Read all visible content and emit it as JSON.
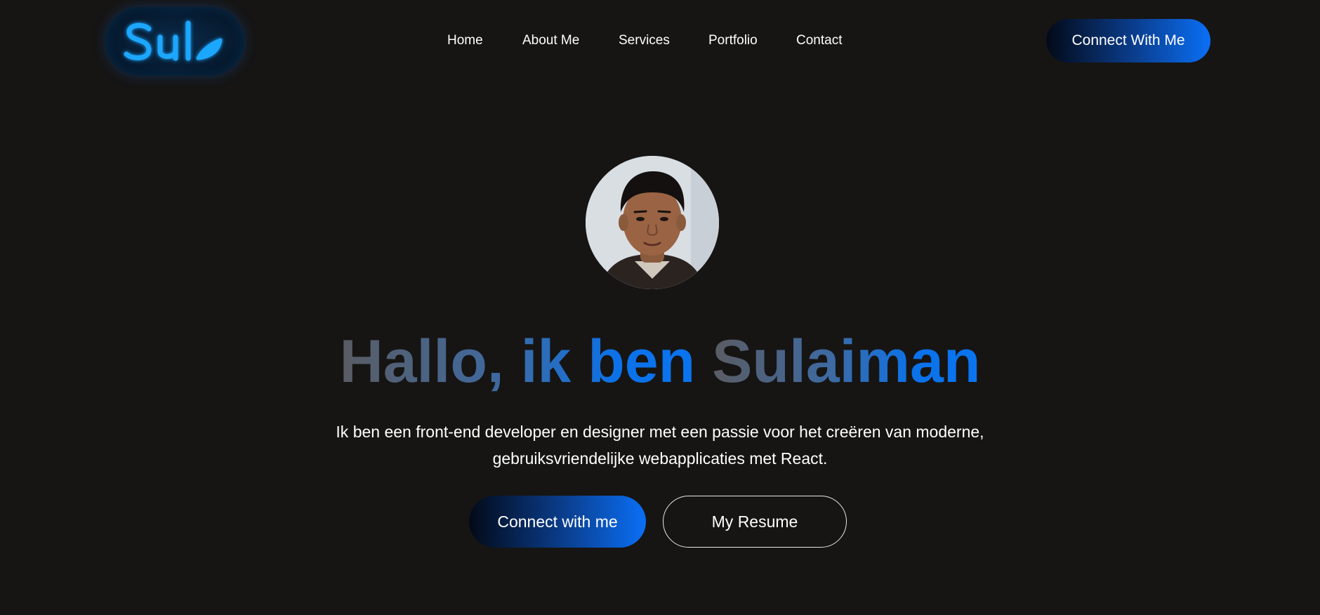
{
  "logo": {
    "text": "Sul",
    "icon": "sul-neon-logo-icon",
    "color": "#1ea7ff"
  },
  "nav": {
    "items": [
      {
        "label": "Home"
      },
      {
        "label": "About Me"
      },
      {
        "label": "Services"
      },
      {
        "label": "Portfolio"
      },
      {
        "label": "Contact"
      }
    ]
  },
  "header": {
    "cta_label": "Connect With Me"
  },
  "hero": {
    "avatar_icon": "profile-photo-avatar",
    "title_part1": "Hallo, ik ben ",
    "title_part2": "Sulaiman",
    "description": "Ik ben een front-end developer en designer met een passie voor het creëren van moderne, gebruiksvriendelijke webapplicaties met React.",
    "primary_button": "Connect with me",
    "secondary_button": "My Resume"
  },
  "colors": {
    "background": "#161514",
    "accent": "#0a6ff5",
    "gradient_start": "#030a18",
    "text": "#ffffff"
  }
}
